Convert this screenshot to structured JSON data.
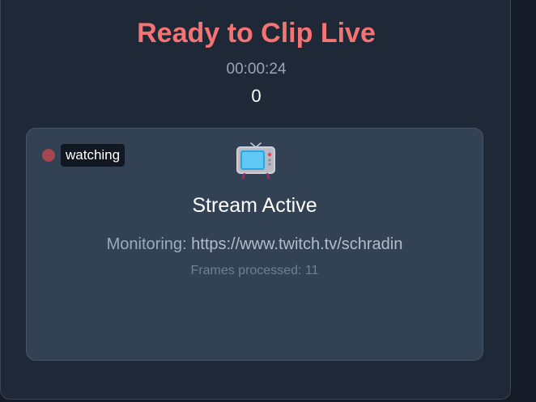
{
  "header": {
    "title": "Ready to Clip Live",
    "timer": "00:00:24",
    "clip_count": "0"
  },
  "stream_card": {
    "status_label": "watching",
    "status_color": "#a54650",
    "icon": "television-icon",
    "title": "Stream Active",
    "monitoring_prefix": "Monitoring:",
    "monitoring_url": "https://www.twitch.tv/schradin",
    "frames_processed": "Frames processed: 11"
  },
  "colors": {
    "title": "#f47373",
    "panel_bg": "#1f2837",
    "card_bg": "#334155"
  }
}
